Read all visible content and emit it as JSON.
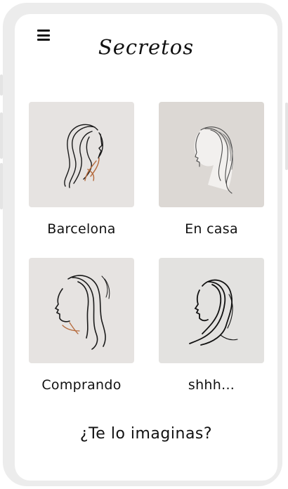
{
  "header": {
    "title": "Secretos",
    "menu_icon": "hamburger-menu-icon"
  },
  "cards": [
    {
      "label": "Barcelona",
      "image": "woman-profile-line-art-copper",
      "bg": "#e6e3e1"
    },
    {
      "label": "En casa",
      "image": "woman-profile-line-art-faded",
      "bg": "#dcd8d4"
    },
    {
      "label": "Comprando",
      "image": "woman-profile-line-art-left",
      "bg": "#e6e3e1"
    },
    {
      "label": "shhh...",
      "image": "woman-profile-line-art-flowing",
      "bg": "#e3e2e0"
    }
  ],
  "footer": {
    "text": "¿Te lo imaginas?"
  },
  "colors": {
    "frame": "#ececec",
    "screen": "#ffffff",
    "text": "#111111",
    "accent_copper": "#b56a3c"
  }
}
